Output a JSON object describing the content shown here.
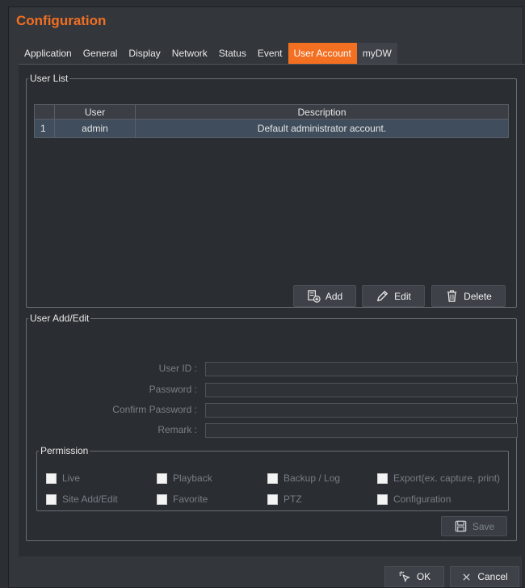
{
  "window": {
    "title": "Configuration"
  },
  "tabs": [
    {
      "label": "Application"
    },
    {
      "label": "General"
    },
    {
      "label": "Display"
    },
    {
      "label": "Network"
    },
    {
      "label": "Status"
    },
    {
      "label": "Event"
    },
    {
      "label": "User Account"
    },
    {
      "label": "myDW"
    }
  ],
  "active_tab": "User Account",
  "user_list": {
    "legend": "User List",
    "columns": [
      "",
      "User",
      "Description"
    ],
    "rows": [
      {
        "index": "1",
        "user": "admin",
        "description": "Default administrator account."
      }
    ],
    "buttons": {
      "add": "Add",
      "edit": "Edit",
      "delete": "Delete"
    }
  },
  "user_edit": {
    "legend": "User Add/Edit",
    "fields": [
      {
        "label": "User ID :",
        "value": ""
      },
      {
        "label": "Password :",
        "value": ""
      },
      {
        "label": "Confirm Password :",
        "value": ""
      },
      {
        "label": "Remark :",
        "value": ""
      }
    ],
    "permission": {
      "legend": "Permission",
      "items": [
        {
          "label": "Live",
          "checked": false
        },
        {
          "label": "Playback",
          "checked": false
        },
        {
          "label": "Backup / Log",
          "checked": false
        },
        {
          "label": "Export(ex. capture, print)",
          "checked": false
        },
        {
          "label": "Site Add/Edit",
          "checked": false
        },
        {
          "label": "Favorite",
          "checked": false
        },
        {
          "label": "PTZ",
          "checked": false
        },
        {
          "label": "Configuration",
          "checked": false
        }
      ]
    },
    "save_label": "Save"
  },
  "footer": {
    "ok_label": "OK",
    "cancel_label": "Cancel"
  },
  "colors": {
    "accent": "#f36f21",
    "background": "#33373c",
    "panel": "#2a2d31",
    "selected_row": "#3f4d5c"
  }
}
